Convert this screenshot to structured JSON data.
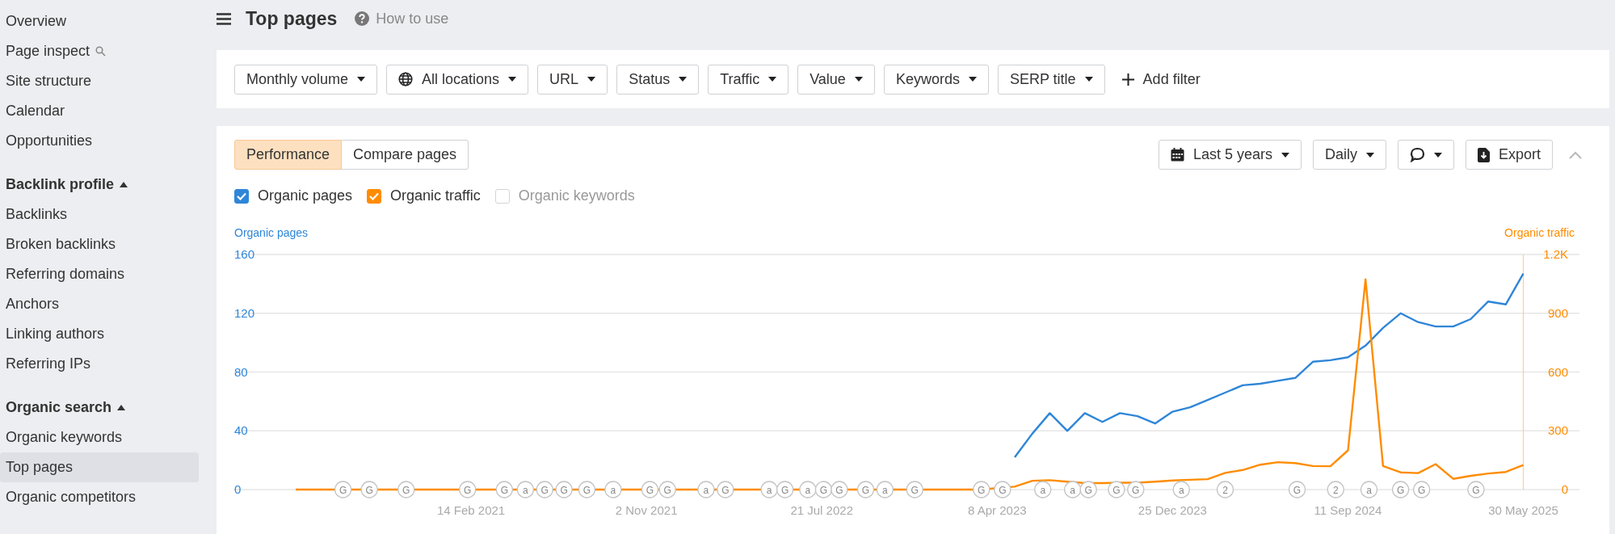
{
  "sidebar": {
    "groups": [
      {
        "items": [
          {
            "label": "Overview",
            "kind": "link",
            "selected": false
          },
          {
            "label": "Page inspect",
            "kind": "search",
            "selected": false
          },
          {
            "label": "Site structure",
            "kind": "link",
            "selected": false
          },
          {
            "label": "Calendar",
            "kind": "link",
            "selected": false
          },
          {
            "label": "Opportunities",
            "kind": "link",
            "selected": false
          }
        ]
      },
      {
        "heading": "Backlink profile",
        "expanded": true,
        "items": [
          {
            "label": "Backlinks",
            "kind": "link",
            "selected": false
          },
          {
            "label": "Broken backlinks",
            "kind": "link",
            "selected": false
          },
          {
            "label": "Referring domains",
            "kind": "link",
            "selected": false
          },
          {
            "label": "Anchors",
            "kind": "link",
            "selected": false
          },
          {
            "label": "Linking authors",
            "kind": "link",
            "selected": false
          },
          {
            "label": "Referring IPs",
            "kind": "link",
            "selected": false
          }
        ]
      },
      {
        "heading": "Organic search",
        "expanded": true,
        "items": [
          {
            "label": "Organic keywords",
            "kind": "link",
            "selected": false
          },
          {
            "label": "Top pages",
            "kind": "link",
            "selected": true
          },
          {
            "label": "Organic competitors",
            "kind": "link",
            "selected": false
          }
        ]
      }
    ]
  },
  "header": {
    "title": "Top pages",
    "help_link": "How to use"
  },
  "filters": [
    {
      "label": "Monthly volume",
      "kind": "dropdown"
    },
    {
      "label": "All locations",
      "kind": "location"
    },
    {
      "label": "URL",
      "kind": "dropdown"
    },
    {
      "label": "Status",
      "kind": "dropdown"
    },
    {
      "label": "Traffic",
      "kind": "dropdown"
    },
    {
      "label": "Value",
      "kind": "dropdown"
    },
    {
      "label": "Keywords",
      "kind": "dropdown"
    },
    {
      "label": "SERP title",
      "kind": "dropdown"
    },
    {
      "label": "Add filter",
      "kind": "add"
    }
  ],
  "chart_panel": {
    "tabs": [
      {
        "label": "Performance",
        "selected": true
      },
      {
        "label": "Compare pages",
        "selected": false
      }
    ],
    "date_range": "Last 5 years",
    "interval": "Daily",
    "export": "Export",
    "legend": [
      {
        "label": "Organic pages",
        "checked": true,
        "color": "#2f86d8"
      },
      {
        "label": "Organic traffic",
        "checked": true,
        "color": "#ff8c00"
      },
      {
        "label": "Organic keywords",
        "checked": false
      }
    ],
    "chart_data": {
      "type": "line",
      "categories": [
        null,
        null,
        null,
        null,
        null,
        null,
        null,
        null,
        null,
        null,
        "14 Feb 2021",
        null,
        null,
        null,
        null,
        null,
        null,
        null,
        null,
        null,
        "2 Nov 2021",
        null,
        null,
        null,
        null,
        null,
        null,
        null,
        null,
        null,
        "21 Jul 2022",
        null,
        null,
        null,
        null,
        null,
        null,
        null,
        null,
        null,
        "8 Apr 2023",
        null,
        null,
        null,
        null,
        null,
        null,
        null,
        null,
        null,
        "25 Dec 2023",
        null,
        null,
        null,
        null,
        null,
        null,
        null,
        null,
        null,
        "11 Sep 2024",
        null,
        null,
        null,
        null,
        null,
        null,
        null,
        null,
        null,
        "30 May 2025"
      ],
      "series": [
        {
          "name": "Organic pages",
          "color": "#2f86d8",
          "values": [
            null,
            null,
            null,
            null,
            null,
            null,
            null,
            null,
            null,
            null,
            null,
            null,
            null,
            null,
            null,
            null,
            null,
            null,
            null,
            null,
            null,
            null,
            null,
            null,
            null,
            null,
            null,
            null,
            null,
            null,
            null,
            null,
            null,
            null,
            null,
            null,
            null,
            null,
            null,
            null,
            null,
            22,
            38,
            52,
            40,
            52,
            46,
            52,
            50,
            45,
            53,
            56,
            61,
            66,
            71,
            72,
            74,
            76,
            87,
            88,
            90,
            98,
            110,
            120,
            114,
            111,
            111,
            116,
            128,
            126,
            147
          ]
        },
        {
          "name": "Organic traffic",
          "color": "#ff8c00",
          "axis": "y2",
          "values": [
            0,
            0,
            0,
            0,
            null,
            0,
            null,
            0,
            0,
            0,
            null,
            0,
            0,
            0,
            null,
            null,
            0,
            0,
            0,
            0,
            null,
            null,
            0,
            0,
            0,
            0,
            0,
            0,
            0,
            null,
            0,
            0,
            0,
            0,
            0,
            0,
            0,
            0,
            0,
            0,
            null,
            15,
            45,
            48,
            40,
            33,
            33,
            35,
            35,
            40,
            46,
            50,
            53,
            85,
            100,
            127,
            140,
            135,
            120,
            119,
            200,
            1073,
            120,
            88,
            84,
            130,
            55,
            70,
            82,
            90,
            125
          ]
        }
      ],
      "ylim": [
        0,
        160
      ],
      "y2lim": [
        0,
        1200
      ],
      "grid": true,
      "yticks": [
        0,
        40,
        80,
        120,
        160
      ],
      "y2ticks": [
        {
          "value": 0,
          "label": "0"
        },
        {
          "value": 300,
          "label": "300"
        },
        {
          "value": 600,
          "label": "600"
        },
        {
          "value": 900,
          "label": "900"
        },
        {
          "value": 1200,
          "label": "1.2K"
        }
      ]
    },
    "events": [
      "G",
      "G",
      "G",
      "G",
      "G",
      "a",
      "G",
      "G",
      "G",
      "a",
      "G",
      "G",
      "a",
      "G",
      "a",
      "G",
      "a",
      "G",
      "G",
      "G",
      "a",
      "G",
      "G",
      "G",
      "a",
      "a",
      "G",
      "G",
      "G",
      "a",
      "2",
      "G",
      "2",
      "a",
      "G",
      "G",
      "G"
    ]
  }
}
